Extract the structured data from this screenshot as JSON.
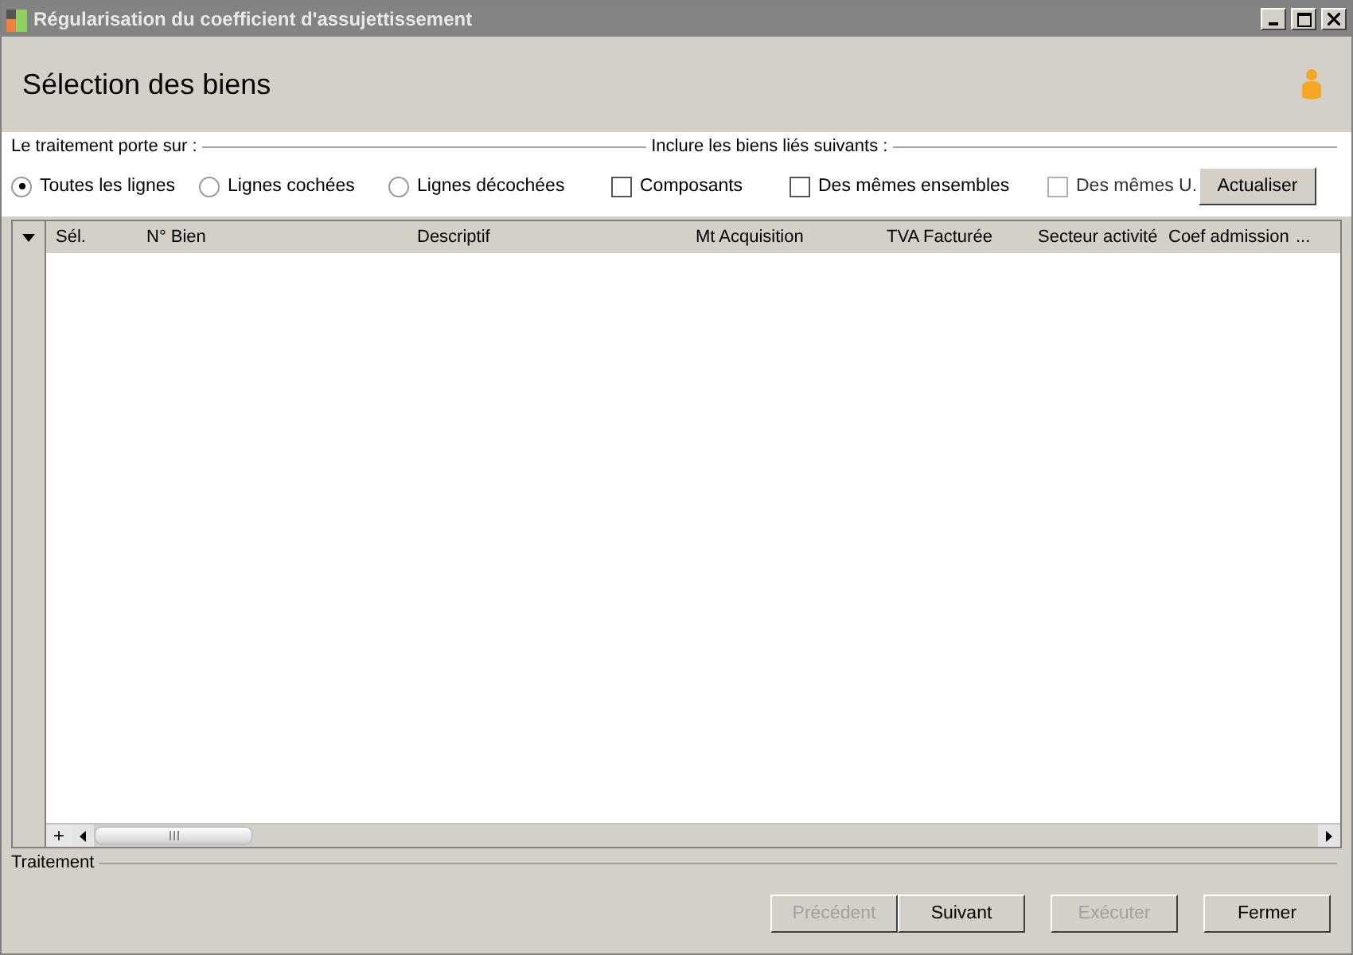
{
  "window": {
    "title": "Régularisation du coefficient d'assujettissement"
  },
  "header": {
    "title": "Sélection des biens"
  },
  "scope": {
    "legend": "Le traitement porte sur :",
    "options": [
      {
        "label": "Toutes les lignes",
        "selected": true
      },
      {
        "label": "Lignes cochées",
        "selected": false
      },
      {
        "label": "Lignes décochées",
        "selected": false
      }
    ]
  },
  "include": {
    "legend": "Inclure les biens liés suivants :",
    "options": [
      {
        "label": "Composants",
        "checked": false,
        "disabled": false
      },
      {
        "label": "Des mêmes ensembles",
        "checked": false,
        "disabled": false
      },
      {
        "label": "Des mêmes U.",
        "checked": false,
        "disabled": true
      }
    ],
    "button": "Actualiser"
  },
  "table": {
    "columns": [
      "Sél.",
      "N° Bien",
      "Descriptif",
      "Mt Acquisition",
      "TVA Facturée",
      "Secteur activité",
      "Coef admission",
      "..."
    ],
    "add_button": "+"
  },
  "footer": {
    "legend": "Traitement",
    "buttons": [
      {
        "label": "Précédent",
        "disabled": true
      },
      {
        "label": "Suivant",
        "disabled": false
      },
      {
        "label": "Exécuter",
        "disabled": true
      },
      {
        "label": "Fermer",
        "disabled": false
      }
    ]
  }
}
